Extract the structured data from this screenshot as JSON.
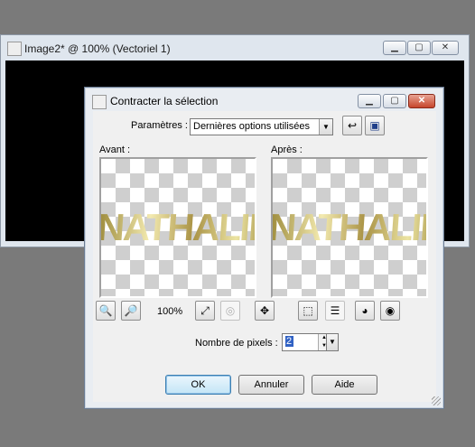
{
  "background_window": {
    "title": "Image2* @ 100% (Vectoriel 1)"
  },
  "dialog": {
    "title": "Contracter la sélection",
    "caption_buttons": {
      "minimize": "▭",
      "maximize": "▢",
      "close": "✕"
    },
    "params_label": "Paramètres :",
    "preset_value": "Dernières options utilisées",
    "before_label": "Avant :",
    "after_label": "Après :",
    "preview_text": "NATHALIE",
    "zoom_level": "100%",
    "pixels_label": "Nombre de pixels :",
    "pixels_value": "2",
    "buttons": {
      "ok": "OK",
      "cancel": "Annuler",
      "help": "Aide"
    }
  },
  "icons": {
    "zoom_out": "magnifier-minus-icon",
    "zoom_in": "magnifier-plus-icon",
    "fit": "fit-window-icon",
    "zoom_disabled": "zoom-disabled-icon",
    "pan": "move-icon",
    "selection": "marquee-icon",
    "preview_toggle": "preview-panel-icon",
    "auto_proof": "eye-check-icon",
    "proof": "eye-icon",
    "reset": "reset-arrow-icon",
    "save_preset": "floppy-disk-icon"
  }
}
